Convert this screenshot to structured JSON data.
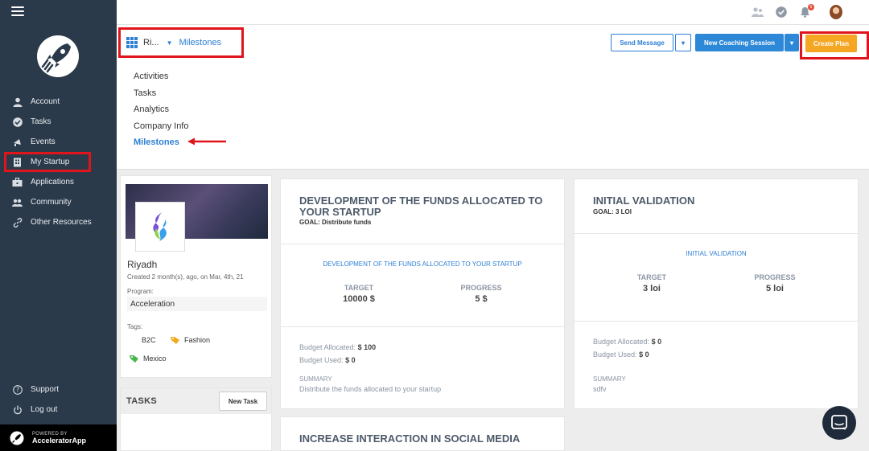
{
  "sidebar": {
    "items": [
      {
        "label": "Account",
        "icon": "user-icon"
      },
      {
        "label": "Tasks",
        "icon": "check-circle-icon"
      },
      {
        "label": "Events",
        "icon": "megaphone-icon"
      },
      {
        "label": "My Startup",
        "icon": "building-icon"
      },
      {
        "label": "Applications",
        "icon": "briefcase-icon"
      },
      {
        "label": "Community",
        "icon": "users-icon"
      },
      {
        "label": "Other Resources",
        "icon": "link-icon"
      }
    ],
    "bottom_items": [
      {
        "label": "Support",
        "icon": "question-icon"
      },
      {
        "label": "Log out",
        "icon": "power-icon"
      }
    ],
    "powered_small": "POWERED BY",
    "powered_big": "AcceleratorApp"
  },
  "topbar": {
    "notification_count": "6"
  },
  "header": {
    "breadcrumb_short": "Ri...",
    "breadcrumb_current": "Milestones",
    "send_message": "Send Message",
    "new_coaching": "New Coaching Session",
    "create_plan": "Create Plan"
  },
  "subnav": [
    "Activities",
    "Tasks",
    "Analytics",
    "Company Info",
    "Milestones"
  ],
  "profile": {
    "name": "Riyadh",
    "created": "Created 2 month(s), ago, on Mar, 4th, 21",
    "program_label": "Program:",
    "program_value": "Acceleration",
    "tags_label": "Tags:",
    "tags": [
      "B2C",
      "Fashion",
      "Mexico"
    ]
  },
  "tasks": {
    "title": "TASKS",
    "new_task": "New Task"
  },
  "milestones": [
    {
      "title": "DEVELOPMENT OF THE FUNDS ALLOCATED TO YOUR STARTUP",
      "goal": "GOAL: Distribute funds",
      "subtitle": "DEVELOPMENT OF THE FUNDS ALLOCATED TO YOUR STARTUP",
      "target_label": "TARGET",
      "target_value": "10000 $",
      "progress_label": "PROGRESS",
      "progress_value": "5 $",
      "budget_allocated_label": "Budget Allocated:",
      "budget_allocated": "$ 100",
      "budget_used_label": "Budget Used:",
      "budget_used": "$ 0",
      "summary_label": "SUMMARY",
      "summary": "Distribute the funds allocated to your startup"
    },
    {
      "title": "INITIAL VALIDATION",
      "goal": "GOAL: 3 LOI",
      "subtitle": "INITIAL VALIDATION",
      "target_label": "TARGET",
      "target_value": "3 loi",
      "progress_label": "PROGRESS",
      "progress_value": "5 loi",
      "budget_allocated_label": "Budget Allocated:",
      "budget_allocated": "$ 0",
      "budget_used_label": "Budget Used:",
      "budget_used": "$ 0",
      "summary_label": "SUMMARY",
      "summary": "sdfv"
    },
    {
      "title": "INCREASE INTERACTION IN SOCIAL MEDIA"
    }
  ],
  "colors": {
    "sidebar_bg": "#2b3a4a",
    "accent_blue": "#2d7fd4",
    "create_orange": "#f5a623",
    "highlight_red": "#e0141b"
  }
}
